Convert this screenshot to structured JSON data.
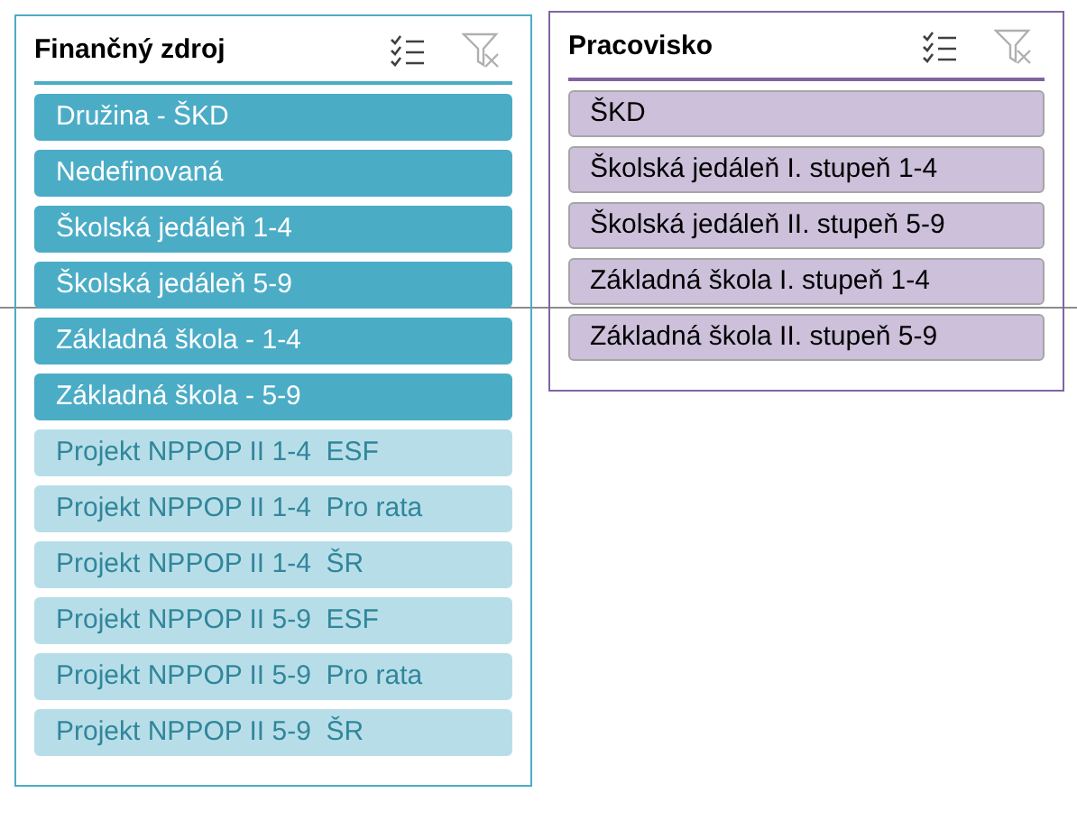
{
  "slicers": [
    {
      "title": "Finančný zdroj",
      "color": "#4bacc6",
      "items": [
        {
          "label": "Družina - ŠKD",
          "selected": true
        },
        {
          "label": "Nedefinovaná",
          "selected": true
        },
        {
          "label": "Školská jedáleň 1-4",
          "selected": true
        },
        {
          "label": "Školská jedáleň 5-9",
          "selected": true
        },
        {
          "label": "Základná škola - 1-4",
          "selected": true
        },
        {
          "label": "Základná škola - 5-9",
          "selected": true
        },
        {
          "label": "Projekt NPPOP II 1-4  ESF",
          "selected": false
        },
        {
          "label": "Projekt NPPOP II 1-4  Pro rata",
          "selected": false
        },
        {
          "label": "Projekt NPPOP II 1-4  ŠR",
          "selected": false
        },
        {
          "label": "Projekt NPPOP II 5-9  ESF",
          "selected": false
        },
        {
          "label": "Projekt NPPOP II 5-9  Pro rata",
          "selected": false
        },
        {
          "label": "Projekt NPPOP II 5-9  ŠR",
          "selected": false
        }
      ]
    },
    {
      "title": "Pracovisko",
      "color": "#8064a2",
      "items": [
        {
          "label": "ŠKD",
          "selected": true
        },
        {
          "label": "Školská jedáleň I. stupeň 1-4",
          "selected": true
        },
        {
          "label": "Školská jedáleň II. stupeň 5-9",
          "selected": true
        },
        {
          "label": "Základná škola I. stupeň 1-4",
          "selected": true
        },
        {
          "label": "Základná škola II. stupeň 5-9",
          "selected": true
        }
      ]
    }
  ]
}
